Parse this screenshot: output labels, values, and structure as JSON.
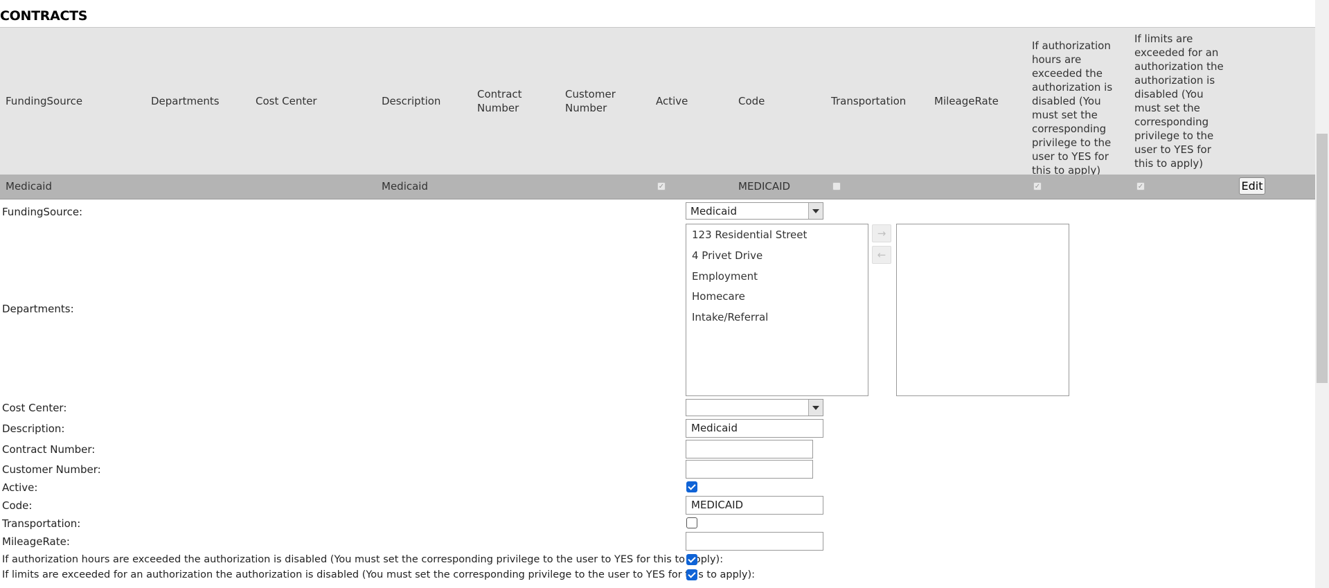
{
  "page": {
    "title": "CONTRACTS"
  },
  "grid": {
    "headers": {
      "funding_source": "FundingSource",
      "departments": "Departments",
      "cost_center": "Cost Center",
      "description": "Description",
      "contract_number": "Contract Number",
      "customer_number": "Customer Number",
      "active": "Active",
      "code": "Code",
      "transportation": "Transportation",
      "mileage_rate": "MileageRate",
      "auth_hours_exceeded": "If authorization hours are exceeded the authorization is disabled (You must set the corresponding privilege to the user to YES for this to apply)",
      "limits_exceeded": "If limits are exceeded for an authorization the authorization is disabled (You must set the corresponding privilege to the user to YES for this to apply)"
    },
    "row": {
      "funding_source": "Medicaid",
      "departments": "",
      "cost_center": "",
      "description": "Medicaid",
      "contract_number": "",
      "customer_number": "",
      "active": true,
      "code": "MEDICAID",
      "transportation": false,
      "mileage_rate": "",
      "auth_hours_exceeded": true,
      "limits_exceeded": true,
      "edit_label": "Edit"
    }
  },
  "form": {
    "funding_source": {
      "label": "FundingSource:",
      "value": "Medicaid"
    },
    "departments": {
      "label": "Departments:",
      "available": [
        "123 Residential Street",
        "4 Privet Drive",
        "Employment",
        "Homecare",
        "Intake/Referral"
      ],
      "selected": [],
      "move_right_icon": "arrow-right-icon",
      "move_left_icon": "arrow-left-icon"
    },
    "cost_center": {
      "label": "Cost Center:",
      "value": ""
    },
    "description": {
      "label": "Description:",
      "value": "Medicaid"
    },
    "contract_number": {
      "label": "Contract Number:",
      "value": ""
    },
    "customer_number": {
      "label": "Customer Number:",
      "value": ""
    },
    "active": {
      "label": "Active:",
      "checked": true
    },
    "code": {
      "label": "Code:",
      "value": "MEDICAID"
    },
    "transportation": {
      "label": "Transportation:",
      "checked": false
    },
    "mileage_rate": {
      "label": "MileageRate:",
      "value": ""
    },
    "auth_hours_exceeded": {
      "label": "If authorization hours are exceeded the authorization is disabled (You must set the corresponding privilege to the user to YES for this to apply):",
      "checked": true
    },
    "limits_exceeded": {
      "label": "If limits are exceeded for an authorization the authorization is disabled (You must set the corresponding privilege to the user to YES for this to apply):",
      "checked": true
    }
  },
  "colors": {
    "accent": "#0f63d6",
    "header_bg": "#e5e5e5",
    "row_bg": "#b4b4b4"
  }
}
